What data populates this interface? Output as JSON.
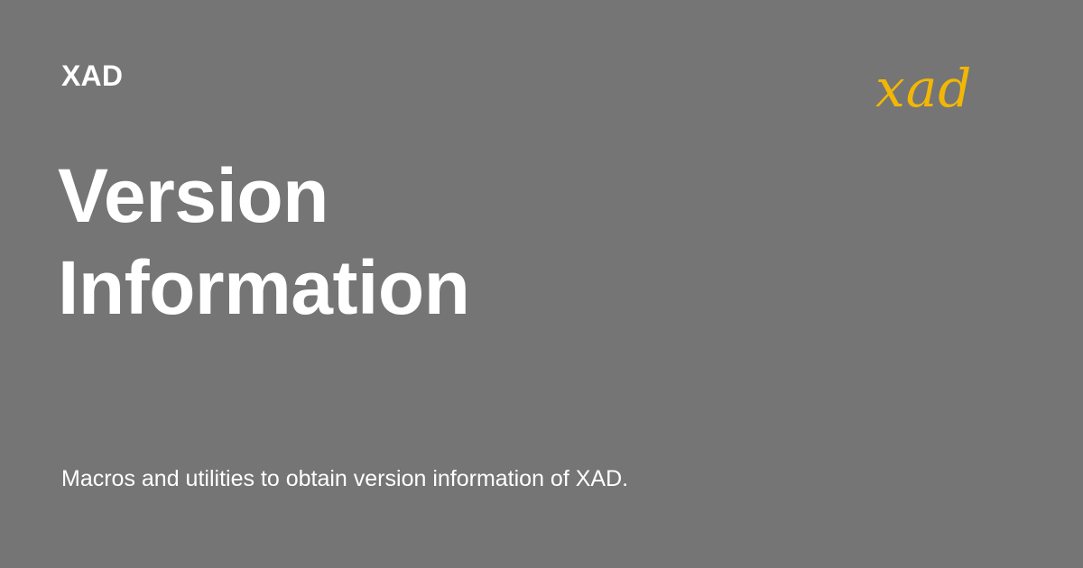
{
  "site": {
    "name": "XAD",
    "logo_text": "xad"
  },
  "page": {
    "title_line_1": "Version",
    "title_line_2": "Information",
    "description": "Macros and utilities to obtain version information of XAD."
  },
  "colors": {
    "background": "#757575",
    "text": "#ffffff",
    "logo": "#f2b705"
  },
  "icons": {
    "logo": "xad-logo-icon"
  }
}
